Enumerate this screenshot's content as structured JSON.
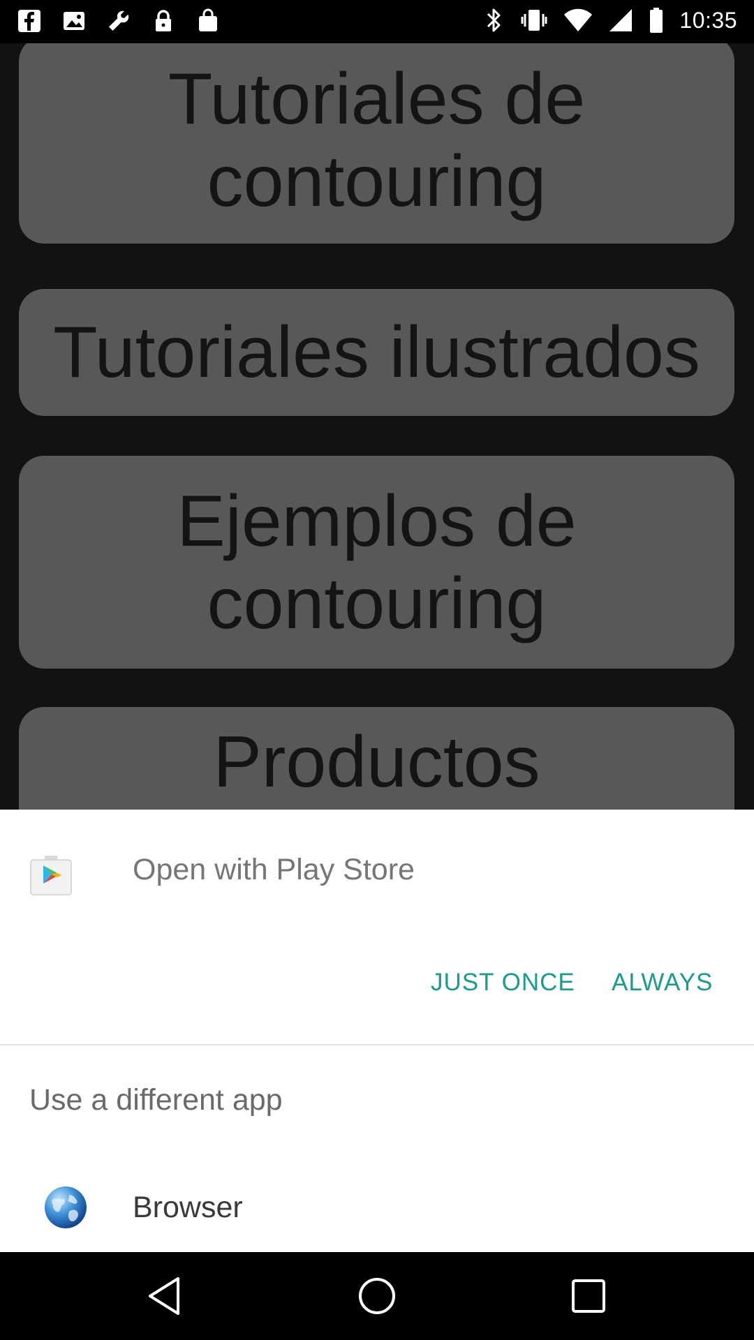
{
  "status_bar": {
    "time": "10:35",
    "left_icons": [
      "facebook-icon",
      "image-icon",
      "wrench-icon",
      "lock-icon",
      "shopping-bag-icon"
    ],
    "right_icons": [
      "bluetooth-icon",
      "vibrate-icon",
      "wifi-icon",
      "signal-icon",
      "battery-icon"
    ]
  },
  "app": {
    "cards": [
      {
        "line1": "Tutoriales de",
        "line2": "contouring"
      },
      {
        "line1": "Tutoriales ilustrados",
        "line2": ""
      },
      {
        "line1": "Ejemplos de",
        "line2": "contouring"
      },
      {
        "line1": "Productos",
        "line2": ""
      }
    ],
    "card_color": "#585858"
  },
  "chooser": {
    "title": "Open with Play Store",
    "just_once_label": "JUST ONCE",
    "always_label": "ALWAYS",
    "different_app_label": "Use a different app",
    "browser_label": "Browser",
    "accent_color": "#1b9b8a"
  },
  "nav": {
    "buttons": [
      "back-icon",
      "home-icon",
      "recents-icon"
    ]
  }
}
